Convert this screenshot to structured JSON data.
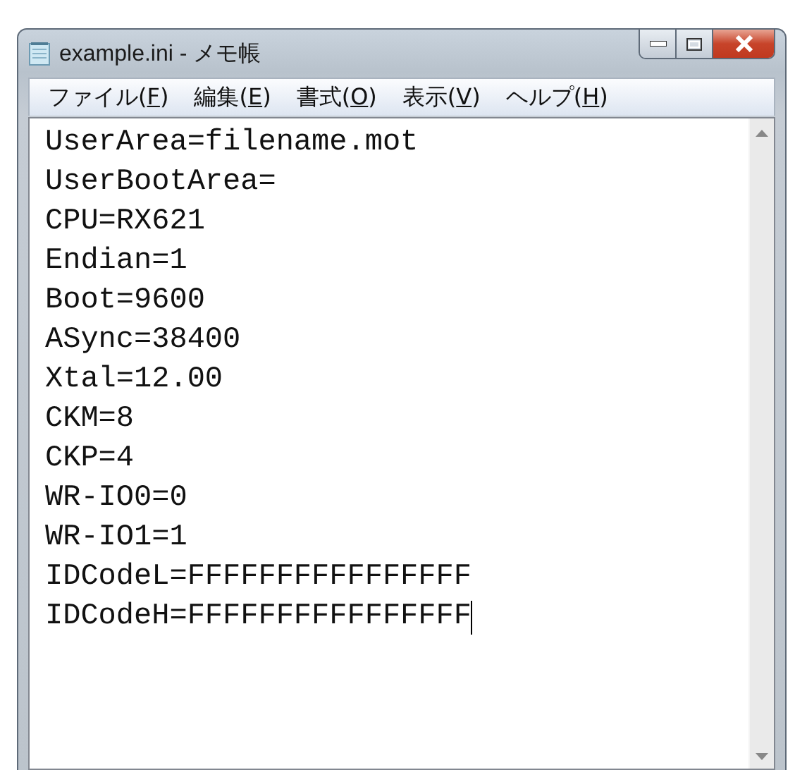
{
  "window": {
    "title": "example.ini - メモ帳"
  },
  "menu": [
    {
      "label": "ファイル(",
      "access_key": "F",
      "label_end": ")"
    },
    {
      "label": "編集(",
      "access_key": "E",
      "label_end": ")"
    },
    {
      "label": "書式(",
      "access_key": "O",
      "label_end": ")"
    },
    {
      "label": "表示(",
      "access_key": "V",
      "label_end": ")"
    },
    {
      "label": "ヘルプ(",
      "access_key": "H",
      "label_end": ")"
    }
  ],
  "editor": {
    "lines": [
      {
        "text": "UserArea=filename.mot",
        "caret": false
      },
      {
        "text": "UserBootArea=",
        "caret": false
      },
      {
        "text": "CPU=RX621",
        "caret": false
      },
      {
        "text": "Endian=1",
        "caret": false
      },
      {
        "text": "Boot=9600",
        "caret": false
      },
      {
        "text": "ASync=38400",
        "caret": false
      },
      {
        "text": "Xtal=12.00",
        "caret": false
      },
      {
        "text": "CKM=8",
        "caret": false
      },
      {
        "text": "CKP=4",
        "caret": false
      },
      {
        "text": "WR-IO0=0",
        "caret": false
      },
      {
        "text": "WR-IO1=1",
        "caret": false
      },
      {
        "text": "IDCodeL=FFFFFFFFFFFFFFFF",
        "caret": false
      },
      {
        "text": "IDCodeH=FFFFFFFFFFFFFFFF",
        "caret": true
      }
    ]
  }
}
